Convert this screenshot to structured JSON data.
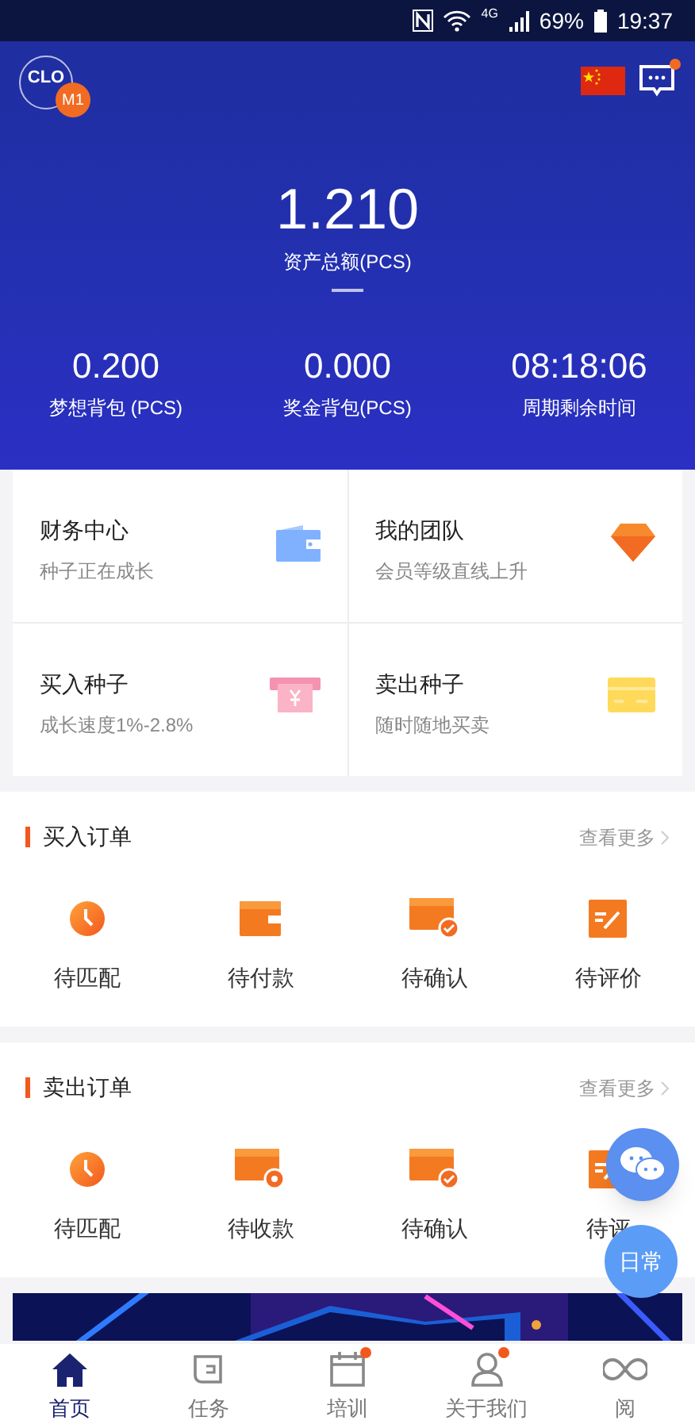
{
  "status_bar": {
    "network": "4G",
    "battery": "69%",
    "time": "19:37"
  },
  "header": {
    "logo": {
      "text": "CLO",
      "badge": "M1"
    },
    "message_unread": true,
    "total": {
      "value": "1.210",
      "label": "资产总额(PCS)"
    },
    "stats": [
      {
        "value": "0.200",
        "label": "梦想背包 (PCS)"
      },
      {
        "value": "0.000",
        "label": "奖金背包(PCS)"
      },
      {
        "value": "08:18:06",
        "label": "周期剩余时间"
      }
    ]
  },
  "cards": [
    {
      "kind": "wallet",
      "title": "财务中心",
      "subtitle": "种子正在成长"
    },
    {
      "kind": "gem",
      "title": "我的团队",
      "subtitle": "会员等级直线上升"
    },
    {
      "kind": "ticket",
      "title": "买入种子",
      "subtitle": "成长速度1%-2.8%"
    },
    {
      "kind": "card",
      "title": "卖出种子",
      "subtitle": "随时随地买卖"
    }
  ],
  "order_sections": [
    {
      "title": "买入订单",
      "more": "查看更多",
      "items": [
        {
          "kind": "clock",
          "label": "待匹配"
        },
        {
          "kind": "wallet",
          "label": "待付款"
        },
        {
          "kind": "check",
          "label": "待确认"
        },
        {
          "kind": "review",
          "label": "待评价"
        }
      ]
    },
    {
      "title": "卖出订单",
      "more": "查看更多",
      "items": [
        {
          "kind": "clock",
          "label": "待匹配"
        },
        {
          "kind": "coin",
          "label": "待收款"
        },
        {
          "kind": "check",
          "label": "待确认"
        },
        {
          "kind": "review",
          "label": "待评"
        }
      ]
    }
  ],
  "floating": {
    "daily": "日常"
  },
  "tab_bar": [
    {
      "kind": "home",
      "label": "首页",
      "selected": true,
      "dot": false
    },
    {
      "kind": "task",
      "label": "任务",
      "selected": false,
      "dot": false
    },
    {
      "kind": "calendar",
      "label": "培训",
      "selected": false,
      "dot": true
    },
    {
      "kind": "person",
      "label": "关于我们",
      "selected": false,
      "dot": true
    },
    {
      "kind": "infinity",
      "label": "阅",
      "selected": false,
      "dot": false
    }
  ]
}
